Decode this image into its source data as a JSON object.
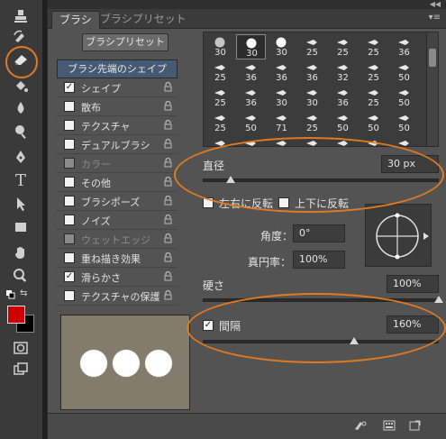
{
  "toolbar": {
    "tools": [
      "stamp-icon",
      "history-brush-icon",
      "eraser-icon",
      "paint-bucket-icon",
      "blur-icon",
      "dodge-icon",
      "pen-icon",
      "type-icon",
      "path-selection-icon",
      "rectangle-icon",
      "hand-icon",
      "zoom-icon"
    ],
    "foreground_color": "#cc0000",
    "background_color": "#000000"
  },
  "panel": {
    "tabs": [
      "ブラシ",
      "ブラシプリセット"
    ],
    "preset_button": "ブラシプリセット",
    "settings": {
      "header": "ブラシ先端のシェイプ",
      "items": [
        {
          "label": "シェイプ",
          "checked": true,
          "disabled": false
        },
        {
          "label": "散布",
          "checked": false,
          "disabled": false
        },
        {
          "label": "テクスチャ",
          "checked": false,
          "disabled": false
        },
        {
          "label": "デュアルブラシ",
          "checked": false,
          "disabled": false
        },
        {
          "label": "カラー",
          "checked": false,
          "disabled": true
        },
        {
          "label": "その他",
          "checked": false,
          "disabled": false
        },
        {
          "label": "ブラシポーズ",
          "checked": false,
          "disabled": false
        },
        {
          "label": "ノイズ",
          "checked": false,
          "disabled": false
        },
        {
          "label": "ウェットエッジ",
          "checked": false,
          "disabled": true
        },
        {
          "label": "重ね描き効果",
          "checked": false,
          "disabled": false
        },
        {
          "label": "滑らかさ",
          "checked": true,
          "disabled": false
        },
        {
          "label": "テクスチャの保護",
          "checked": false,
          "disabled": false
        }
      ]
    },
    "brush_grid": {
      "sizes": [
        [
          "30",
          "30",
          "30",
          "25",
          "25",
          "25",
          "36"
        ],
        [
          "25",
          "36",
          "36",
          "36",
          "32",
          "25",
          "50"
        ],
        [
          "25",
          "36",
          "30",
          "30",
          "36",
          "25",
          "50"
        ],
        [
          "25",
          "50",
          "71",
          "25",
          "50",
          "50",
          "50"
        ],
        [
          "50",
          "36",
          "30",
          "30",
          "30",
          "20",
          "9"
        ]
      ]
    },
    "diameter": {
      "label": "直径",
      "value": "30 px",
      "level": 0.12
    },
    "flip_x": {
      "label": "左右に反転",
      "checked": false
    },
    "flip_y": {
      "label": "上下に反転",
      "checked": false
    },
    "angle": {
      "label": "角度：",
      "value": "0°"
    },
    "roundness": {
      "label": "真円率：",
      "value": "100%"
    },
    "hardness": {
      "label": "硬さ",
      "value": "100%",
      "level": 1.0
    },
    "spacing": {
      "label": "間隔",
      "value": "160%",
      "checked": true,
      "level": 0.64
    }
  },
  "accent_color": "#e07a22"
}
